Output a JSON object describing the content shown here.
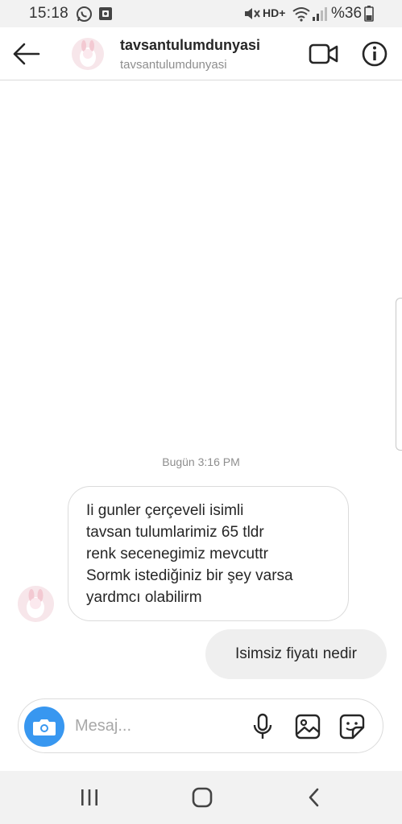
{
  "status_bar": {
    "time": "15:18",
    "network": "HD+",
    "battery": "%36",
    "icons": [
      "whatsapp-icon",
      "gallery-notification-icon",
      "mute-icon",
      "wifi-icon",
      "signal-icon",
      "battery-icon"
    ]
  },
  "header": {
    "title": "tavsantulumdunyasi",
    "subtitle": "tavsantulumdunyasi",
    "icons": [
      "back-arrow-icon",
      "video-call-icon",
      "info-icon"
    ]
  },
  "chat": {
    "timestamp": "Bugün 3:16 PM",
    "messages": [
      {
        "direction": "incoming",
        "text": "Ii gunler çerçeveli isimli\ntavsan tulumlarimiz 65 tldr\nrenk secenegimiz mevcuttr\nSormk istediğiniz bir şey varsa\nyardmcı olabilirm"
      },
      {
        "direction": "outgoing",
        "text": "Isimsiz fiyatı nedir"
      }
    ]
  },
  "composer": {
    "placeholder": "Mesaj...",
    "icons": [
      "camera-icon",
      "microphone-icon",
      "gallery-icon",
      "sticker-icon"
    ]
  },
  "colors": {
    "accent": "#3897f0",
    "outgoing_bubble": "#efefef",
    "border": "#dbdbdb",
    "muted_text": "#8e8e8e"
  }
}
